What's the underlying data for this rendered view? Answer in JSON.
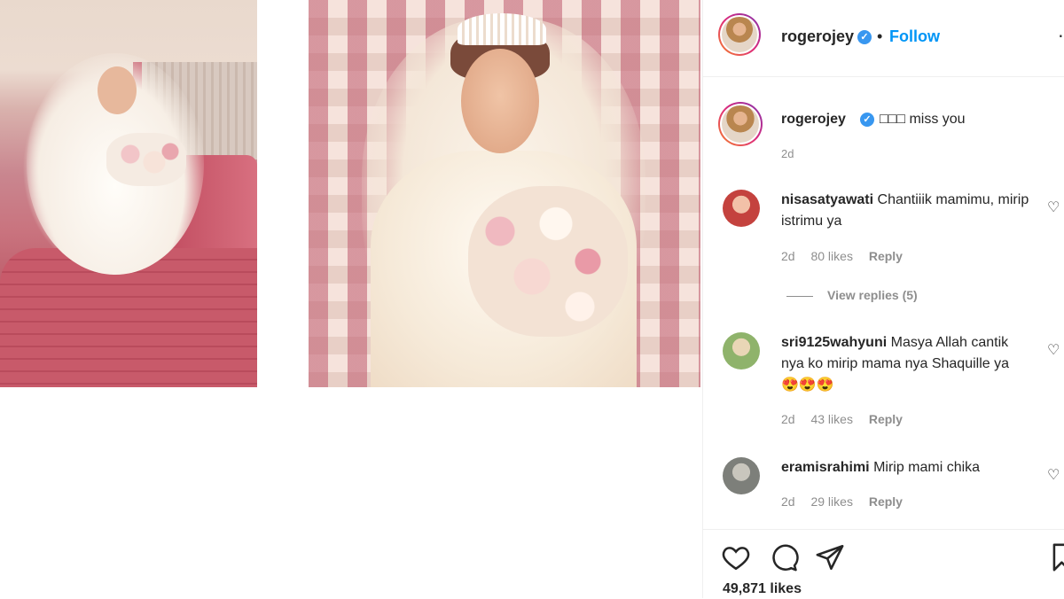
{
  "post": {
    "username": "rogerojey",
    "follow_label": "Follow",
    "separator": "•",
    "caption": "□□□ miss you",
    "caption_time": "2d",
    "likes": "49,871 likes"
  },
  "comments": [
    {
      "username": "nisasatyawati",
      "text": "Chantiiik mamimu, mirip istrimu ya",
      "time": "2d",
      "likes": "80 likes",
      "reply": "Reply",
      "avatar_color": "#c4423e"
    },
    {
      "username": "sri9125wahyuni",
      "text": "Masya Allah cantik nya ko mirip mama nya Shaquille ya 😍😍😍",
      "time": "2d",
      "likes": "43 likes",
      "reply": "Reply",
      "avatar_color": "#8fb36b"
    },
    {
      "username": "eramisrahimi",
      "text": "Mirip mami chika",
      "time": "2d",
      "likes": "29 likes",
      "reply": "Reply",
      "avatar_color": "#7d7f7a"
    }
  ],
  "view_replies": "View replies (5)",
  "icons": {
    "verified": "verified-badge-icon",
    "like": "heart-icon",
    "comment": "comment-icon",
    "share": "share-icon",
    "save": "bookmark-icon",
    "more": "more-options-icon"
  },
  "colors": {
    "follow": "#0095f6",
    "verified": "#3897f0",
    "muted": "#8e8e8e"
  }
}
